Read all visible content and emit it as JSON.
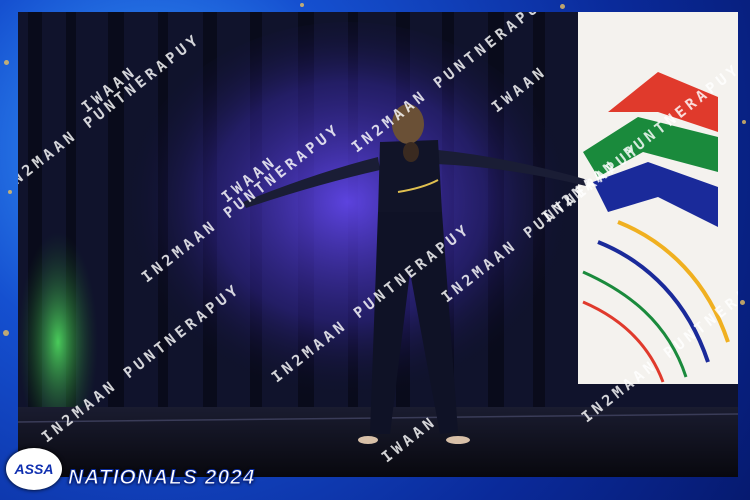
{
  "photo": {
    "subject": "dancer",
    "backdrop": "stage-curtain",
    "banner": "flag-banner"
  },
  "watermark": {
    "line_a": "IN2MAAN PUNTNERAPUY",
    "line_b": "IWAAN"
  },
  "branding": {
    "logo_text": "ASSA",
    "event_title": "NATIONALS 2024"
  },
  "colors": {
    "frame": "#1550d0",
    "curtain": "#14183a",
    "spotlight": "#5a3cff",
    "green_light": "#3cd050",
    "flag_red": "#e03a2c",
    "flag_green": "#1a8a3c",
    "flag_blue": "#1a2a9a",
    "flag_gold": "#f0b020"
  }
}
